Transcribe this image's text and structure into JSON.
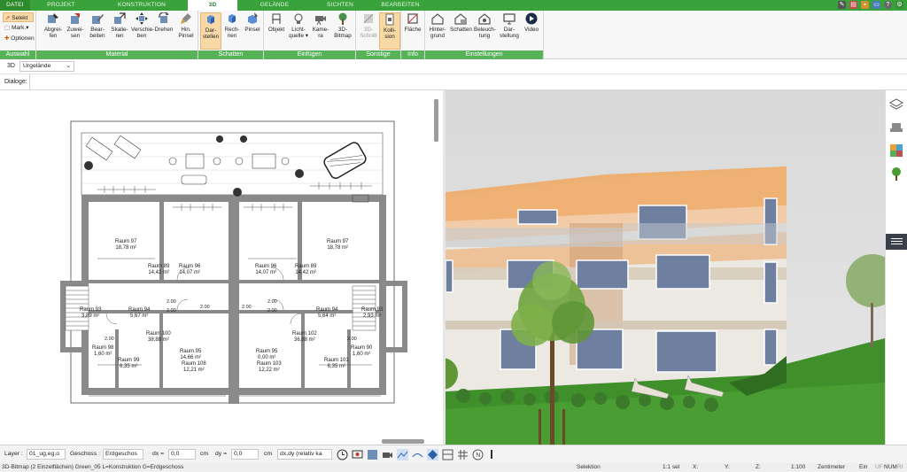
{
  "tabs": [
    {
      "label": "DATEI",
      "active": false
    },
    {
      "label": "PROJEKT",
      "active": false
    },
    {
      "label": "KONSTRUKTION",
      "active": false
    },
    {
      "label": "3D",
      "active": true
    },
    {
      "label": "GELÄNDE",
      "active": false
    },
    {
      "label": "SICHTEN",
      "active": false
    },
    {
      "label": "BEARBEITEN",
      "active": false
    }
  ],
  "ribbon": {
    "auswahl": {
      "label": "Auswahl",
      "selekt": "Selekt",
      "mark": "Mark.",
      "optionen": "Optionen"
    },
    "material": {
      "label": "Material",
      "buttons": [
        "Abgrei-\nfen",
        "Zuwei-\nsen",
        "Bear-\nbeiten",
        "Skalie-\nren",
        "Verschie-\nben",
        "Drehen",
        "Hin.\nPinsel"
      ]
    },
    "schatten": {
      "label": "Schatten",
      "buttons": [
        "Dar-\nstellen",
        "Rech-\nnen",
        "Pinsel"
      ]
    },
    "einfuegen": {
      "label": "Einfügen",
      "buttons": [
        "Objekt",
        "Licht-\nquelle ▾",
        "Kame-\nra",
        "3D-\nBitmap"
      ]
    },
    "sonstige": {
      "label": "Sonstige",
      "buttons": [
        "3D-\nSchnitt",
        "Kolli-\nsion"
      ]
    },
    "info": {
      "label": "Info",
      "buttons": [
        "Fläche"
      ]
    },
    "einstellungen": {
      "label": "Einstellungen",
      "buttons": [
        "Hinter-\ngrund",
        "Schatten",
        "Beleuch-\ntung",
        "Dar-\nstellung",
        "Video"
      ]
    }
  },
  "viewbar": {
    "mode": "3D",
    "terrain": "Urgelände"
  },
  "dialogbar": {
    "label": "Dialoge:"
  },
  "plan": {
    "rooms": [
      {
        "name": "Raum 97",
        "area": "18,78 m²"
      },
      {
        "name": "Raum 96",
        "area": "14,07 m²"
      },
      {
        "name": "Raum 96",
        "area": "14,07 m²"
      },
      {
        "name": "Raum 97",
        "area": "18,78 m²"
      },
      {
        "name": "Raum 89",
        "area": "14,42 m²"
      },
      {
        "name": "Raum 89",
        "area": "14,42 m²"
      },
      {
        "name": "Raum 94",
        "area": "5,67 m²"
      },
      {
        "name": "Raum 94",
        "area": "5,64 m²"
      },
      {
        "name": "Raum 93",
        "area": "3,89 m²"
      },
      {
        "name": "Raum 93",
        "area": "2,93 m²"
      },
      {
        "name": "Raum 100",
        "area": "38,88 m²"
      },
      {
        "name": "Raum 102",
        "area": "36,88 m²"
      },
      {
        "name": "Raum 95",
        "area": "14,66 m²"
      },
      {
        "name": "Raum 95",
        "area": "0,00 m²"
      },
      {
        "name": "Raum 108",
        "area": "12,21 m²"
      },
      {
        "name": "Raum 103",
        "area": "12,22 m²"
      },
      {
        "name": "Raum 98",
        "area": "1,60 m²"
      },
      {
        "name": "Raum 90",
        "area": "1,60 m²"
      },
      {
        "name": "Raum 99",
        "area": "6,35 m²"
      },
      {
        "name": "Raum 101",
        "area": "6,35 m²"
      }
    ],
    "dims": [
      "2.00",
      "2.00",
      "2.00",
      "2.00",
      "2.00",
      "2.00",
      "2.00",
      "2.00"
    ]
  },
  "bottombar": {
    "layer_label": "Layer :",
    "layer_value": "01_ug,eg,o",
    "geschoss_label": "Geschoss :",
    "geschoss_value": "Erdgeschos",
    "dx_label": "dx =",
    "dx_value": "0,0",
    "dy_label": "dy =",
    "dy_value": "0,0",
    "unit": "cm",
    "mode_value": "dx,dy (relativ ka"
  },
  "status": {
    "message": "3D-Bitmap (2 Einzelflächen) Green_05 L=Konstruktion G=Erdgeschoss",
    "selektion": "Selektion",
    "sel": "1:1 sel",
    "x": "X:",
    "y": "Y:",
    "z": "Z:",
    "scale": "1:100",
    "unit": "Zentimeter",
    "ein": "Ein",
    "uf": "UF",
    "num": "NUM",
    "ri": "RI"
  },
  "colors": {
    "green": "#3aa23a",
    "accent": "#58b358",
    "highlight": "#f6d9a6"
  }
}
